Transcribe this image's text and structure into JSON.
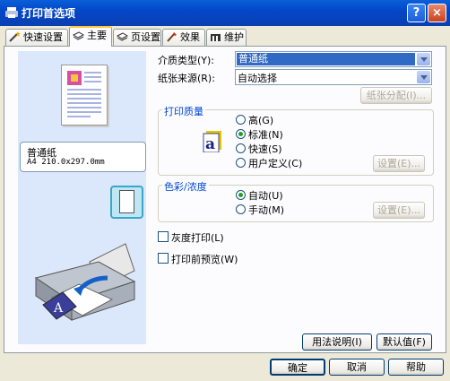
{
  "window": {
    "title": "打印首选项",
    "help_glyph": "?",
    "close_glyph": "×"
  },
  "tabs": [
    {
      "label": "快速设置",
      "active": false
    },
    {
      "label": "主要",
      "active": true
    },
    {
      "label": "页设置",
      "active": false
    },
    {
      "label": "效果",
      "active": false
    },
    {
      "label": "维护",
      "active": false
    }
  ],
  "preview": {
    "media_name": "普通纸",
    "media_size": "A4 210.0x297.0mm"
  },
  "media_type": {
    "label": "介质类型(Y):",
    "value": "普通纸"
  },
  "paper_source": {
    "label": "纸张来源(R):",
    "value": "自动选择",
    "allocation_button": "纸张分配(I)..."
  },
  "print_quality": {
    "title": "打印质量",
    "options": [
      {
        "label": "高(G)",
        "selected": false
      },
      {
        "label": "标准(N)",
        "selected": true
      },
      {
        "label": "快速(S)",
        "selected": false
      },
      {
        "label": "用户定义(C)",
        "selected": false
      }
    ],
    "settings_button": "设置(E)..."
  },
  "color_intensity": {
    "title": "色彩/浓度",
    "options": [
      {
        "label": "自动(U)",
        "selected": true
      },
      {
        "label": "手动(M)",
        "selected": false
      }
    ],
    "settings_button": "设置(E)..."
  },
  "grayscale": {
    "label": "灰度打印(L)",
    "checked": false
  },
  "preview_before_print": {
    "label": "打印前预览(W)",
    "checked": false
  },
  "footer_buttons": {
    "instructions": "用法说明(I)",
    "defaults": "默认值(F)"
  },
  "dialog_buttons": {
    "ok": "确定",
    "cancel": "取消",
    "help": "帮助"
  },
  "colors": {
    "titlebar": "#0347c8",
    "preview_bg": "#dbe7fb",
    "group_title": "#0046d5",
    "selection": "#316ac5"
  }
}
